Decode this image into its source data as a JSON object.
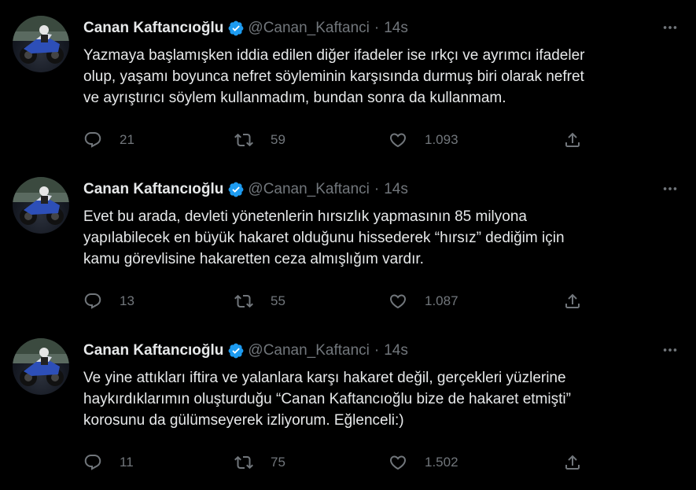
{
  "accent_color": "#1d9bf0",
  "tweets": [
    {
      "name": "Canan Kaftancıoğlu",
      "handle": "@Canan_Kaftanci",
      "dot": "·",
      "time": "14s",
      "text": "Yazmaya başlamışken iddia edilen diğer ifadeler ise ırkçı ve ayrımcı ifadeler\nolup, yaşamı boyunca nefret söyleminin karşısında durmuş biri olarak nefret\nve ayrıştırıcı söylem kullanmadım, bundan sonra da kullanmam.",
      "replies": "21",
      "retweets": "59",
      "likes": "1.093"
    },
    {
      "name": "Canan Kaftancıoğlu",
      "handle": "@Canan_Kaftanci",
      "dot": "·",
      "time": "14s",
      "text": "Evet bu arada, devleti yönetenlerin hırsızlık yapmasının 85 milyona\nyapılabilecek en büyük hakaret olduğunu hissederek “hırsız” dediğim için\nkamu görevlisine hakaretten ceza almışlığım vardır.",
      "replies": "13",
      "retweets": "55",
      "likes": "1.087"
    },
    {
      "name": "Canan Kaftancıoğlu",
      "handle": "@Canan_Kaftanci",
      "dot": "·",
      "time": "14s",
      "text": "Ve yine attıkları iftira ve yalanlara karşı hakaret değil, gerçekleri yüzlerine\nhaykırdıklarımın oluşturduğu “Canan Kaftancıoğlu bize de hakaret etmişti”\nkorosunu da gülümseyerek izliyorum. Eğlenceli:)",
      "replies": "11",
      "retweets": "75",
      "likes": "1.502"
    }
  ]
}
